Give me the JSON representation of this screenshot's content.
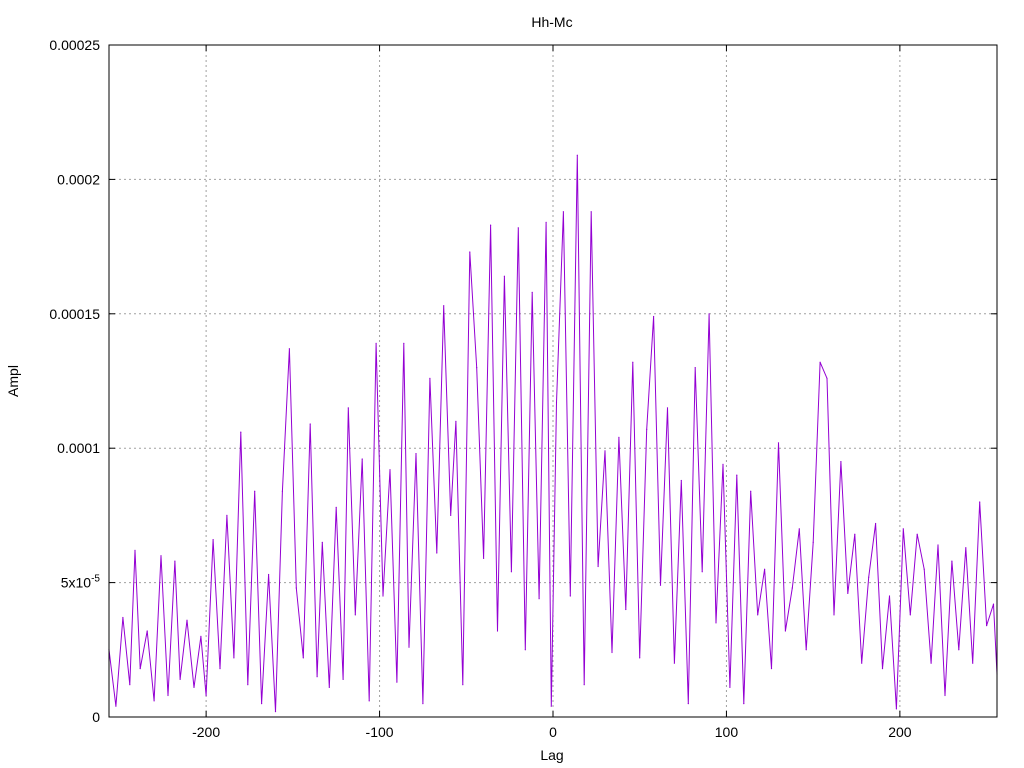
{
  "chart_data": {
    "type": "line",
    "title": "Hh-Mc",
    "xlabel": "Lag",
    "ylabel": "Ampl",
    "xlim": [
      -256,
      256
    ],
    "ylim": [
      0,
      0.00025
    ],
    "grid": true,
    "legend": "none",
    "colors": {
      "series": "#9400d3",
      "axis": "#000000",
      "grid": "#a0a0a0"
    },
    "x_ticks": [
      {
        "value": -200,
        "label": "-200"
      },
      {
        "value": -100,
        "label": "-100"
      },
      {
        "value": 0,
        "label": "0"
      },
      {
        "value": 100,
        "label": "100"
      },
      {
        "value": 200,
        "label": "200"
      }
    ],
    "y_ticks": [
      {
        "value": 0,
        "label": "0"
      },
      {
        "value": 5e-05,
        "label": "5x10",
        "sup": "-5"
      },
      {
        "value": 0.0001,
        "label": "0.0001"
      },
      {
        "value": 0.00015,
        "label": "0.00015"
      },
      {
        "value": 0.0002,
        "label": "0.0002"
      },
      {
        "value": 0.00025,
        "label": "0.00025"
      }
    ],
    "series": [
      {
        "x": [
          -256,
          -252,
          -248,
          -244,
          -241,
          -238,
          -234,
          -230,
          -226,
          -222,
          -218,
          -215,
          -211,
          -207,
          -203,
          -200,
          -196,
          -192,
          -188,
          -184,
          -180,
          -176,
          -172,
          -168,
          -164,
          -160,
          -156,
          -152,
          -148,
          -144,
          -140,
          -136,
          -133,
          -129,
          -125,
          -121,
          -118,
          -114,
          -110,
          -106,
          -102,
          -98,
          -94,
          -90,
          -86,
          -83,
          -79,
          -75,
          -71,
          -67,
          -63,
          -59,
          -56,
          -52,
          -48,
          -44,
          -40,
          -36,
          -32,
          -28,
          -24,
          -20,
          -16,
          -12,
          -8,
          -4,
          -1,
          2,
          6,
          10,
          14,
          18,
          22,
          26,
          30,
          34,
          38,
          42,
          46,
          50,
          54,
          58,
          62,
          66,
          70,
          74,
          78,
          82,
          86,
          90,
          94,
          98,
          102,
          106,
          110,
          114,
          118,
          122,
          126,
          130,
          134,
          138,
          142,
          146,
          150,
          154,
          158,
          162,
          166,
          170,
          174,
          178,
          182,
          186,
          190,
          194,
          198,
          202,
          206,
          210,
          214,
          218,
          222,
          226,
          230,
          234,
          238,
          242,
          246,
          250,
          254,
          256
        ],
        "y": [
          2.5e-05,
          4e-06,
          3.7e-05,
          1.2e-05,
          6.2e-05,
          1.8e-05,
          3.2e-05,
          6e-06,
          6e-05,
          8e-06,
          5.8e-05,
          1.4e-05,
          3.6e-05,
          1.1e-05,
          3e-05,
          8e-06,
          6.6e-05,
          1.8e-05,
          7.5e-05,
          2.2e-05,
          0.000106,
          1.2e-05,
          8.4e-05,
          5e-06,
          5.3e-05,
          2e-06,
          8.4e-05,
          0.000137,
          4.8e-05,
          2.2e-05,
          0.000109,
          1.5e-05,
          6.5e-05,
          1.1e-05,
          7.8e-05,
          1.4e-05,
          0.000115,
          3.8e-05,
          9.6e-05,
          6e-06,
          0.000139,
          4.5e-05,
          9.2e-05,
          1.3e-05,
          0.000139,
          2.6e-05,
          9.8e-05,
          5e-06,
          0.000126,
          6.1e-05,
          0.000153,
          7.5e-05,
          0.00011,
          1.2e-05,
          0.000173,
          0.00013,
          5.9e-05,
          0.000183,
          3.2e-05,
          0.000164,
          5.4e-05,
          0.000182,
          2.5e-05,
          0.000158,
          4.4e-05,
          0.000184,
          4e-06,
          0.000117,
          0.000188,
          4.5e-05,
          0.000209,
          1.2e-05,
          0.000188,
          5.6e-05,
          9.9e-05,
          2.4e-05,
          0.000104,
          4e-05,
          0.000132,
          2.2e-05,
          0.000107,
          0.000149,
          4.9e-05,
          0.000115,
          2e-05,
          8.8e-05,
          5e-06,
          0.00013,
          5.4e-05,
          0.00015,
          3.5e-05,
          9.4e-05,
          1.1e-05,
          9e-05,
          5e-06,
          8.4e-05,
          3.8e-05,
          5.5e-05,
          1.8e-05,
          0.000102,
          3.2e-05,
          4.8e-05,
          7e-05,
          2.5e-05,
          6.5e-05,
          0.000132,
          0.000126,
          3.8e-05,
          9.5e-05,
          4.6e-05,
          6.8e-05,
          2e-05,
          5.2e-05,
          7.2e-05,
          1.8e-05,
          4.5e-05,
          3e-06,
          7e-05,
          3.8e-05,
          6.8e-05,
          5.5e-05,
          2e-05,
          6.4e-05,
          8e-06,
          5.8e-05,
          2.5e-05,
          6.3e-05,
          2e-05,
          8e-05,
          3.4e-05,
          4.2e-05,
          1.6e-05
        ]
      }
    ]
  }
}
